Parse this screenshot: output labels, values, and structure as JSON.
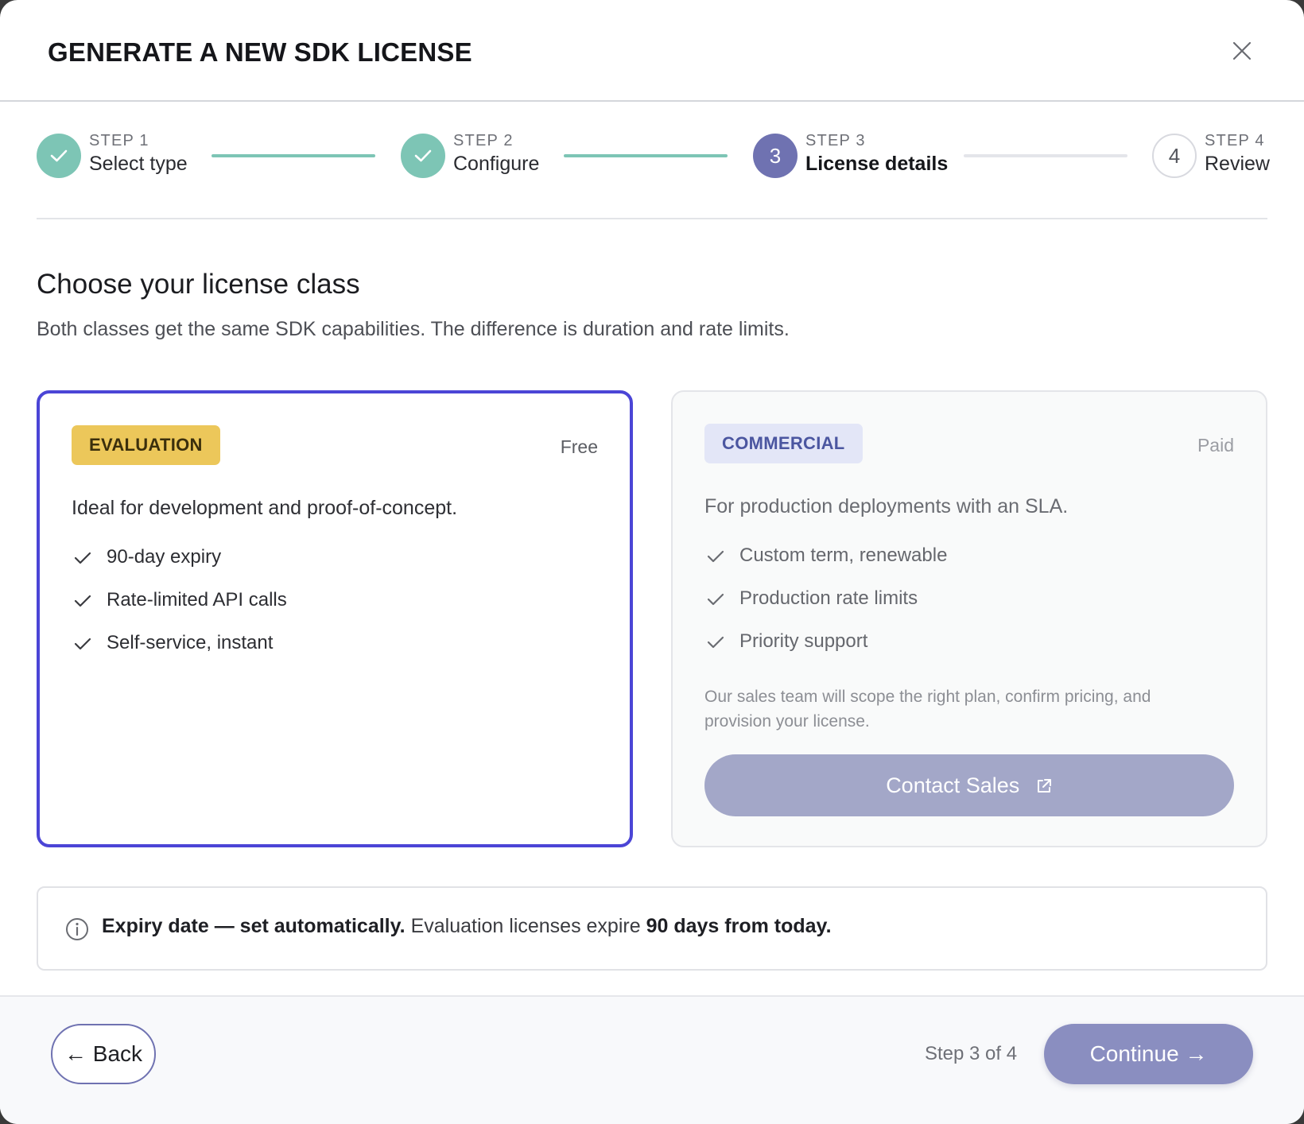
{
  "dialog": {
    "title": "GENERATE A NEW SDK LICENSE",
    "close_icon": "close-icon"
  },
  "stepper": {
    "steps": [
      {
        "kicker": "STEP 1",
        "label": "Select type",
        "state": "done",
        "number": "1"
      },
      {
        "kicker": "STEP 2",
        "label": "Configure",
        "state": "done",
        "number": "2"
      },
      {
        "kicker": "STEP 3",
        "label": "License details",
        "state": "active",
        "number": "3"
      },
      {
        "kicker": "STEP 4",
        "label": "Review",
        "state": "todo",
        "number": "4"
      }
    ]
  },
  "section": {
    "title": "Choose your license class",
    "subtitle": "Both classes get the same SDK capabilities. The difference is duration and rate limits."
  },
  "cards": {
    "evaluation": {
      "badge": "EVALUATION",
      "price": "Free",
      "description": "Ideal for development and proof-of-concept.",
      "features": [
        "90-day expiry",
        "Rate-limited API calls",
        "Self-service, instant"
      ],
      "selected": true
    },
    "commercial": {
      "badge": "COMMERCIAL",
      "price": "Paid",
      "description": "For production deployments with an SLA.",
      "features": [
        "Custom term, renewable",
        "Production rate limits",
        "Priority support"
      ],
      "note": "Our sales team will scope the right plan, confirm pricing, and provision your license.",
      "cta_label": "Contact Sales",
      "cta_icon": "external-link-icon"
    }
  },
  "info": {
    "icon": "info-icon",
    "bold_lead": "Expiry date — set automatically.",
    "text": " Evaluation licenses expire ",
    "bold_tail": "90 days from today."
  },
  "footer": {
    "back_label": "← Back",
    "step_count": "Step 3 of 4",
    "continue_label": "Continue →"
  },
  "colors": {
    "accent": "#4b45d6",
    "step_done": "#7dc5b5",
    "step_active": "#6f72b1",
    "evaluation_badge": "#ecc75a",
    "commercial_badge": "#e3e6f7",
    "primary_button": "#8a8ec0"
  }
}
